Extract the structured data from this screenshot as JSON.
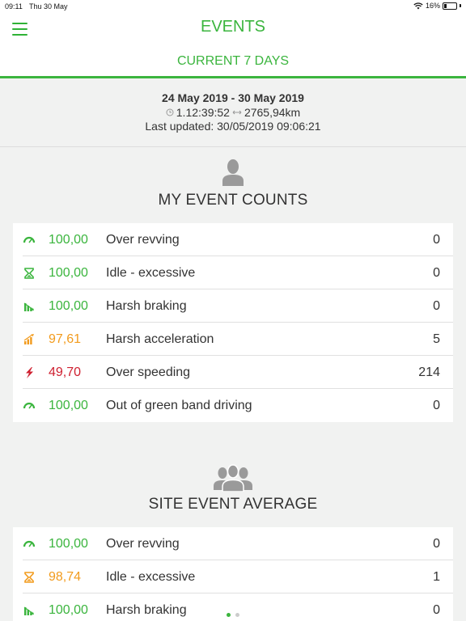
{
  "status_bar": {
    "time": "09:11",
    "date": "Thu 30 May",
    "battery": "16%"
  },
  "nav": {
    "title": "EVENTS"
  },
  "period_tab": {
    "label": "CURRENT 7 DAYS"
  },
  "summary": {
    "range": "24 May 2019 - 30 May 2019",
    "duration": "1.12:39:52",
    "distance": "2765,94km",
    "last_updated": "Last updated: 30/05/2019 09:06:21"
  },
  "sections": {
    "my": {
      "title": "MY EVENT COUNTS",
      "rows": [
        {
          "icon": "gauge-icon",
          "color": "#3bb53e",
          "score": "100,00",
          "label": "Over revving",
          "count": "0"
        },
        {
          "icon": "hourglass-icon",
          "color": "#3bb53e",
          "score": "100,00",
          "label": "Idle - excessive",
          "count": "0"
        },
        {
          "icon": "braking-icon",
          "color": "#3bb53e",
          "score": "100,00",
          "label": "Harsh braking",
          "count": "0"
        },
        {
          "icon": "acceleration-icon",
          "color": "#f29b1d",
          "score": "97,61",
          "label": "Harsh acceleration",
          "count": "5"
        },
        {
          "icon": "lightning-icon",
          "color": "#cf2030",
          "score": "49,70",
          "label": "Over speeding",
          "count": "214"
        },
        {
          "icon": "gauge-icon",
          "color": "#3bb53e",
          "score": "100,00",
          "label": "Out of green band driving",
          "count": "0"
        }
      ]
    },
    "site": {
      "title": "SITE EVENT AVERAGE",
      "rows": [
        {
          "icon": "gauge-icon",
          "color": "#3bb53e",
          "score": "100,00",
          "label": "Over revving",
          "count": "0"
        },
        {
          "icon": "hourglass-icon",
          "color": "#f29b1d",
          "score": "98,74",
          "label": "Idle - excessive",
          "count": "1"
        },
        {
          "icon": "braking-icon",
          "color": "#3bb53e",
          "score": "100,00",
          "label": "Harsh braking",
          "count": "0"
        }
      ]
    }
  },
  "pager": {
    "pages": 2,
    "active": 0
  }
}
